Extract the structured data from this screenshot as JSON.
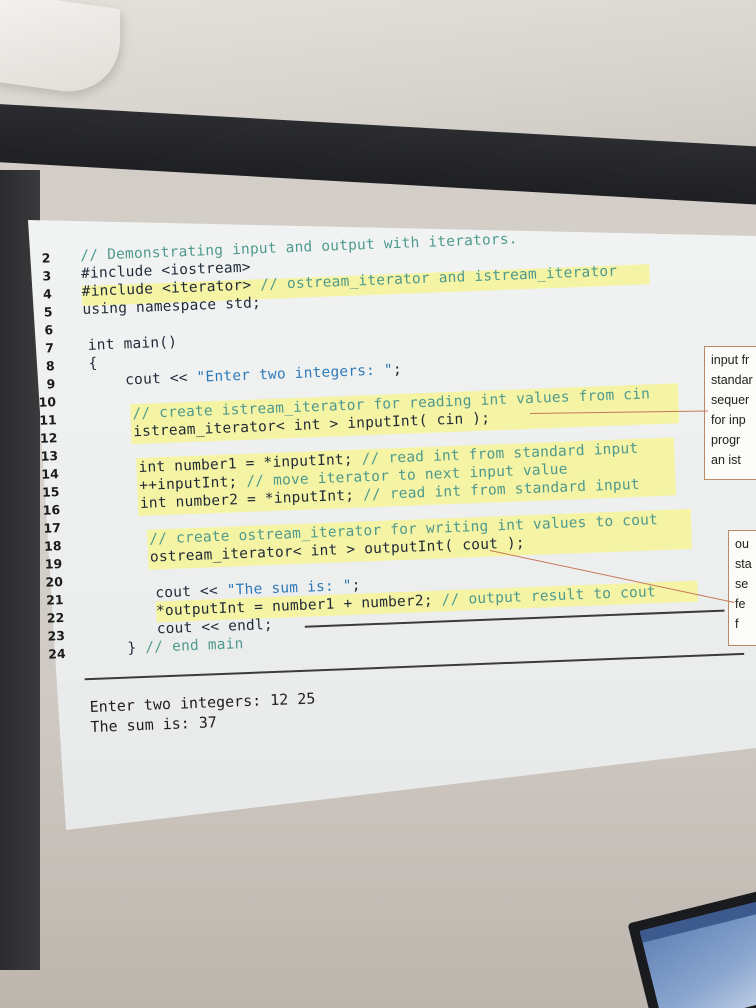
{
  "line_numbers": [
    "2",
    "3",
    "4",
    "5",
    "6",
    "7",
    "8",
    "9",
    "10",
    "11",
    "12",
    "13",
    "14",
    "15",
    "16",
    "17",
    "18",
    "19",
    "20",
    "21",
    "22",
    "23",
    "24"
  ],
  "code": {
    "l2_comment": "// Demonstrating input and output with iterators.",
    "l3_code": "#include <iostream>",
    "l4_code": "#include <iterator>",
    "l4_comment": " // ostream_iterator and istream_iterator",
    "l5_code": "using namespace std;",
    "l7_code": "int main()",
    "l8_code": "{",
    "l9_code": "cout << ",
    "l9_string": "\"Enter two integers: \"",
    "l9_tail": ";",
    "l11_comment": "// create istream_iterator for reading int values from cin",
    "l12_code": "istream_iterator< int > inputInt( cin );",
    "l14_code": "int number1 = *inputInt;",
    "l14_comment": " // read int from standard input",
    "l15_code": "++inputInt;",
    "l15_comment": " // move iterator to next input value",
    "l16_code": "int number2 = *inputInt;",
    "l16_comment": " // read int from standard input",
    "l18_comment": "// create ostream_iterator for writing int values to cout",
    "l19_code": "ostream_iterator< int > outputInt( cout );",
    "l21_code": "cout << ",
    "l21_string": "\"The sum is: \"",
    "l21_tail": ";",
    "l22_code": "*outputInt = number1 + number2;",
    "l22_comment": " // output result to cout",
    "l23_code": "cout << endl;",
    "l24_code": "}",
    "l24_comment": " // end main"
  },
  "output": {
    "line1": "Enter two integers: 12 25",
    "line2": "The sum is: 37"
  },
  "callouts": {
    "top": [
      "input fr",
      "standar",
      "sequer",
      "for inp",
      "progr",
      "an ist"
    ],
    "bottom": [
      "ou",
      "sta",
      "se",
      "fe",
      "f"
    ]
  },
  "colors": {
    "highlight": "#f5f3a4",
    "comment": "#4e9a8e",
    "string": "#2e7ab8",
    "arrow": "#c8785a"
  }
}
